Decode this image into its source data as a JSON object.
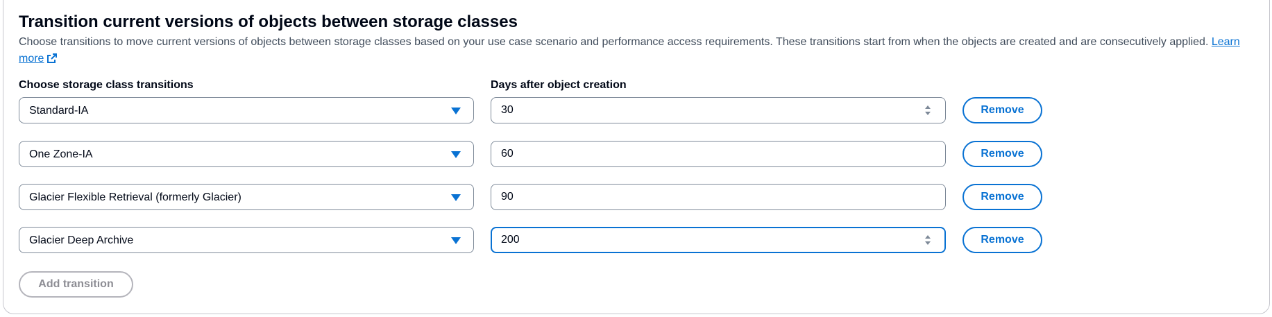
{
  "section": {
    "title": "Transition current versions of objects between storage classes",
    "description": "Choose transitions to move current versions of objects between storage classes based on your use case scenario and performance access requirements. These transitions start from when the objects are created and are consecutively applied.",
    "learn_more": "Learn more"
  },
  "columns": {
    "storage_class": "Choose storage class transitions",
    "days": "Days after object creation"
  },
  "transitions": [
    {
      "storage_class": "Standard-IA",
      "days": "30",
      "remove_label": "Remove"
    },
    {
      "storage_class": "One Zone-IA",
      "days": "60",
      "remove_label": "Remove"
    },
    {
      "storage_class": "Glacier Flexible Retrieval (formerly Glacier)",
      "days": "90",
      "remove_label": "Remove"
    },
    {
      "storage_class": "Glacier Deep Archive",
      "days": "200",
      "remove_label": "Remove"
    }
  ],
  "add_transition_label": "Add transition",
  "colors": {
    "accent": "#0972d3",
    "border": "#7d8998",
    "disabled": "#8d8d94"
  },
  "icons": {
    "dropdown": "caret-down-icon",
    "external": "external-link-icon",
    "spinner": "number-spinner-icon"
  }
}
